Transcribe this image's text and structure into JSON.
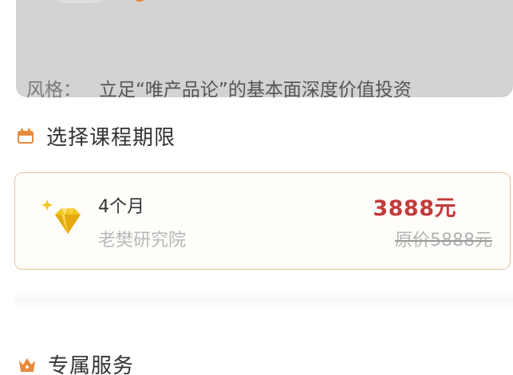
{
  "info_card": {
    "style_label": "风格：",
    "style_value": "立足“唯产品论”的基本面深度价值投资"
  },
  "course_period": {
    "heading": "选择课程期限",
    "plan": {
      "duration": "4个月",
      "provider": "老樊研究院",
      "price": "3888元",
      "original_price": "原价5888元"
    }
  },
  "exclusive_services": {
    "heading": "专属服务"
  },
  "colors": {
    "accent_orange": "#e88a3c",
    "price_red": "#c43a3a",
    "card_border": "#e4c3a0",
    "diamond_gold": "#f2c623"
  },
  "icons": {
    "course_period": "calendar-icon",
    "plan": "diamond-icon",
    "exclusive_services": "crown-icon"
  }
}
